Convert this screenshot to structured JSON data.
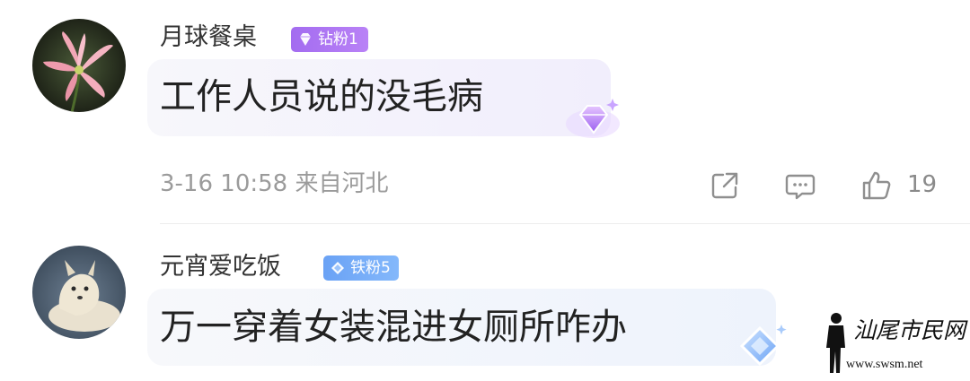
{
  "comments": [
    {
      "username": "月球餐桌",
      "badge": "钻粉1",
      "badge_color": "#a36cf0",
      "text": "工作人员说的没毛病",
      "meta": "3-16 10:58 来自河北",
      "avatar": "lily-flower-avatar",
      "actions": {
        "share_icon": "share-icon",
        "comment_icon": "comment-icon",
        "like_icon": "thumbs-up-icon",
        "like_count": "19"
      }
    },
    {
      "username": "元宵爱吃饭",
      "badge": "铁粉5",
      "badge_color": "#6aa2f5",
      "text": "万一穿着女装混进女厕所咋办",
      "avatar": "white-fox-avatar"
    }
  ],
  "watermark": {
    "title": "汕尾市民网",
    "url": "www.swsm.net"
  }
}
